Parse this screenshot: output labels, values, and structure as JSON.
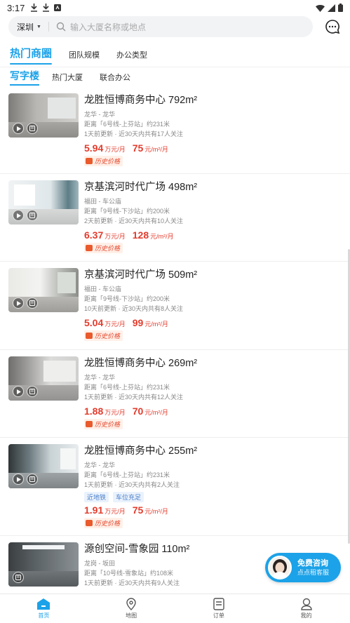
{
  "status_bar": {
    "time": "3:17"
  },
  "search": {
    "city": "深圳",
    "placeholder": "输入大厦名称或地点"
  },
  "main_tabs": [
    "热门商圈",
    "团队规模",
    "办公类型"
  ],
  "sub_tabs": [
    "写字楼",
    "热门大厦",
    "联合办公"
  ],
  "listings": [
    {
      "title": "龙胜恒博商务中心 792m²",
      "area": "龙华 - 龙华",
      "distance": "距离「6号线-上芬站」约231米",
      "update": "1天前更新 · 近30天内共有17人关注",
      "tags": [],
      "total_price": "5.94",
      "total_unit": "万元/月",
      "unit_price": "75",
      "unit_price_unit": "元/m²/月",
      "history": "历史价格"
    },
    {
      "title": "京基滨河时代广场 498m²",
      "area": "福田 - 车公庙",
      "distance": "距离「9号线-下沙站」约200米",
      "update": "2天前更新 · 近30天内共有10人关注",
      "tags": [],
      "total_price": "6.37",
      "total_unit": "万元/月",
      "unit_price": "128",
      "unit_price_unit": "元/m²/月",
      "history": "历史价格"
    },
    {
      "title": "京基滨河时代广场 509m²",
      "area": "福田 - 车公庙",
      "distance": "距离「9号线-下沙站」约200米",
      "update": "10天前更新 · 近30天内共有8人关注",
      "tags": [],
      "total_price": "5.04",
      "total_unit": "万元/月",
      "unit_price": "99",
      "unit_price_unit": "元/m²/月",
      "history": "历史价格"
    },
    {
      "title": "龙胜恒博商务中心 269m²",
      "area": "龙华 - 龙华",
      "distance": "距离「6号线-上芬站」约231米",
      "update": "1天前更新 · 近30天内共有12人关注",
      "tags": [],
      "total_price": "1.88",
      "total_unit": "万元/月",
      "unit_price": "70",
      "unit_price_unit": "元/m²/月",
      "history": "历史价格"
    },
    {
      "title": "龙胜恒博商务中心 255m²",
      "area": "龙华 - 龙华",
      "distance": "距离「6号线-上芬站」约231米",
      "update": "1天前更新 · 近30天内共有2人关注",
      "tags": [
        "近地铁",
        "车位充足"
      ],
      "total_price": "1.91",
      "total_unit": "万元/月",
      "unit_price": "75",
      "unit_price_unit": "元/m²/月",
      "history": "历史价格"
    },
    {
      "title": "源创空间-雪象园 110m²",
      "area": "龙岗 - 坂田",
      "distance": "距离「10号线-雪象站」约108米",
      "update": "1天前更新 · 近30天内共有9人关注",
      "tags": [],
      "total_price": "",
      "total_unit": "",
      "unit_price": "",
      "unit_price_unit": "",
      "history": ""
    }
  ],
  "service": {
    "title": "免费咨询",
    "subtitle": "点点租客服"
  },
  "bottom_nav": [
    {
      "label": "首页",
      "icon": "home-icon"
    },
    {
      "label": "地图",
      "icon": "map-pin-icon"
    },
    {
      "label": "订单",
      "icon": "order-icon"
    },
    {
      "label": "我的",
      "icon": "profile-icon"
    }
  ],
  "colors": {
    "accent": "#1ca2e8",
    "price": "#e33b2c"
  }
}
